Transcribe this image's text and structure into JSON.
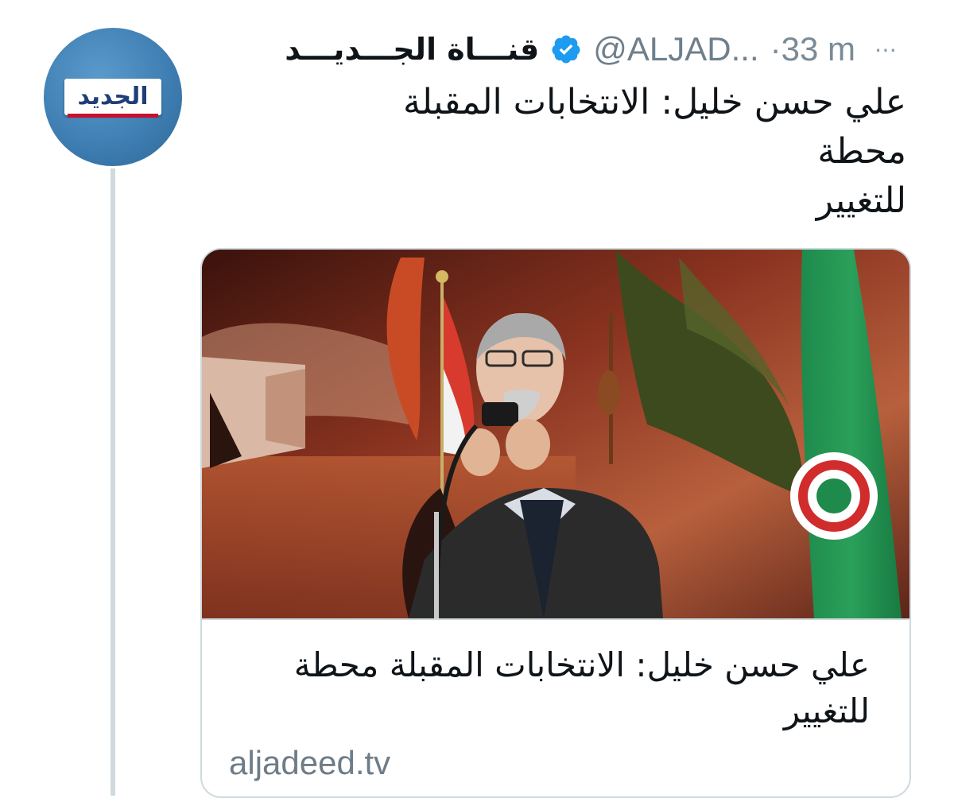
{
  "author": {
    "display_name": "قنـــاة الجـــديـــد",
    "handle": "@ALJAD...",
    "verified": true,
    "avatar_text": "الجديد"
  },
  "tweet": {
    "timestamp": "·33 m",
    "more_icon": "⋯",
    "text_line1": "علي حسن خليل: الانتخابات المقبلة محطة",
    "text_line2": "للتغيير"
  },
  "card": {
    "image": "speaker-at-podium-with-flags",
    "title_line1": "علي حسن خليل: الانتخابات المقبلة محطة",
    "title_line2": "للتغيير",
    "domain": "aljadeed.tv"
  },
  "colors": {
    "verified": "#1d9bf0",
    "avatar_bg": "#4682b4",
    "logo_text": "#1f3e78",
    "muted_text": "#7a8b97",
    "thread_line": "#cfd9de",
    "card_border": "#cfd9de"
  }
}
